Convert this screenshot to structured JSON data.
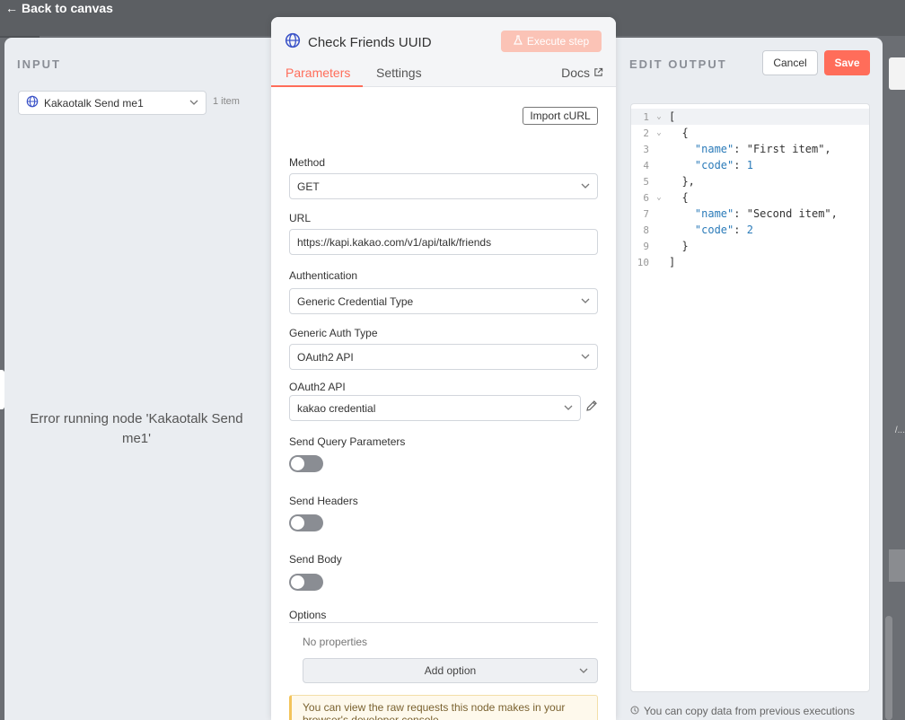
{
  "window": {
    "back_label": "Back to canvas"
  },
  "input": {
    "title": "INPUT",
    "node_name": "Kakaotalk Send me1",
    "item_count": "1 item",
    "error": "Error running node 'Kakaotalk Send me1'"
  },
  "node": {
    "title": "Check Friends UUID",
    "execute_label": "Execute step",
    "tabs": {
      "parameters": "Parameters",
      "settings": "Settings",
      "docs": "Docs"
    },
    "import_curl": "Import cURL",
    "method": {
      "label": "Method",
      "value": "GET"
    },
    "url": {
      "label": "URL",
      "value": "https://kapi.kakao.com/v1/api/talk/friends"
    },
    "authentication": {
      "label": "Authentication",
      "value": "Generic Credential Type"
    },
    "generic_auth_type": {
      "label": "Generic Auth Type",
      "value": "OAuth2 API"
    },
    "oauth2_api": {
      "label": "OAuth2 API",
      "value": "kakao credential"
    },
    "send_query": {
      "label": "Send Query Parameters",
      "enabled": false
    },
    "send_headers": {
      "label": "Send Headers",
      "enabled": false
    },
    "send_body": {
      "label": "Send Body",
      "enabled": false
    },
    "options": {
      "label": "Options",
      "empty": "No properties",
      "add_label": "Add option"
    },
    "notice": "You can view the raw requests this node makes in your browser's developer console"
  },
  "output": {
    "title": "EDIT OUTPUT",
    "cancel_label": "Cancel",
    "save_label": "Save",
    "copy_hint": "You can copy data from previous executions",
    "lines": [
      {
        "n": "1",
        "fold": true,
        "text": "["
      },
      {
        "n": "2",
        "fold": true,
        "text": "  {"
      },
      {
        "n": "3",
        "fold": false,
        "key": "\"name\"",
        "sep": ": ",
        "val": "\"First item\"",
        "tail": ",",
        "indent": "    "
      },
      {
        "n": "4",
        "fold": false,
        "key": "\"code\"",
        "sep": ": ",
        "num": "1",
        "tail": "",
        "indent": "    "
      },
      {
        "n": "5",
        "fold": false,
        "text": "  },"
      },
      {
        "n": "6",
        "fold": true,
        "text": "  {"
      },
      {
        "n": "7",
        "fold": false,
        "key": "\"name\"",
        "sep": ": ",
        "val": "\"Second item\"",
        "tail": ",",
        "indent": "    "
      },
      {
        "n": "8",
        "fold": false,
        "key": "\"code\"",
        "sep": ": ",
        "num": "2",
        "tail": "",
        "indent": "    "
      },
      {
        "n": "9",
        "fold": false,
        "text": "  }"
      },
      {
        "n": "10",
        "fold": false,
        "text": "]"
      }
    ]
  },
  "colors": {
    "accent": "#ff6d5a",
    "execute_disabled": "#fbc3b6",
    "toggle_off": "#8a8d93",
    "json_key": "#2b7bb9"
  }
}
